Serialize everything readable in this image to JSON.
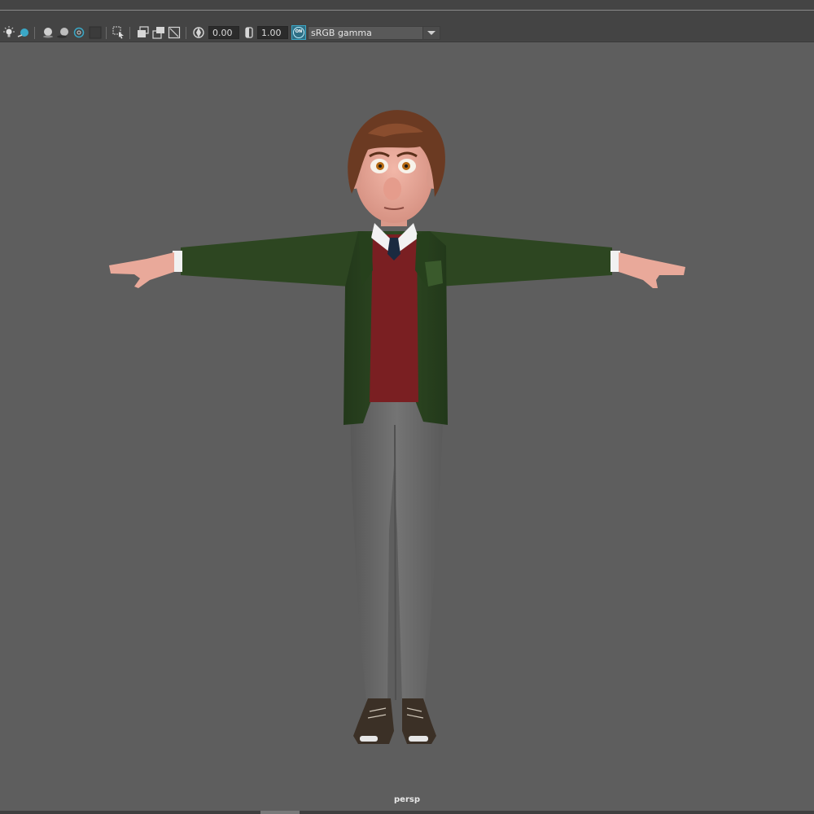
{
  "toolbar": {
    "exposure_value": "0.00",
    "gamma_value": "1.00",
    "color_mgmt_badge": "ON",
    "colorspace_label": "sRGB gamma",
    "icons": [
      "light-bulb-icon",
      "shaded-sphere-icon",
      "textured-sphere-icon",
      "wireframe-sphere-icon",
      "occlusion-icon",
      "grid-icon",
      "select-cursor-icon",
      "copy-layers-icon",
      "copy-layers-icon",
      "isolate-select-icon",
      "exposure-icon",
      "gamma-icon",
      "color-management-icon",
      "dropdown-arrow-icon"
    ],
    "colors": {
      "toolbar_bg": "#444444",
      "viewport_bg": "#5e5e5e",
      "accent_cyan": "#3aa8c7"
    }
  },
  "viewport": {
    "camera_name": "persp"
  },
  "scene": {
    "subject": "3D cartoon character in T-pose",
    "colors": {
      "hair": "#6b3a22",
      "skin": "#e9a99a",
      "jacket": "#2d4621",
      "sweater": "#7a1f22",
      "shirt": "#f2f2f2",
      "tie": "#1a2a40",
      "pants": "#6b6b6b",
      "shoes": "#3a2f24"
    }
  }
}
